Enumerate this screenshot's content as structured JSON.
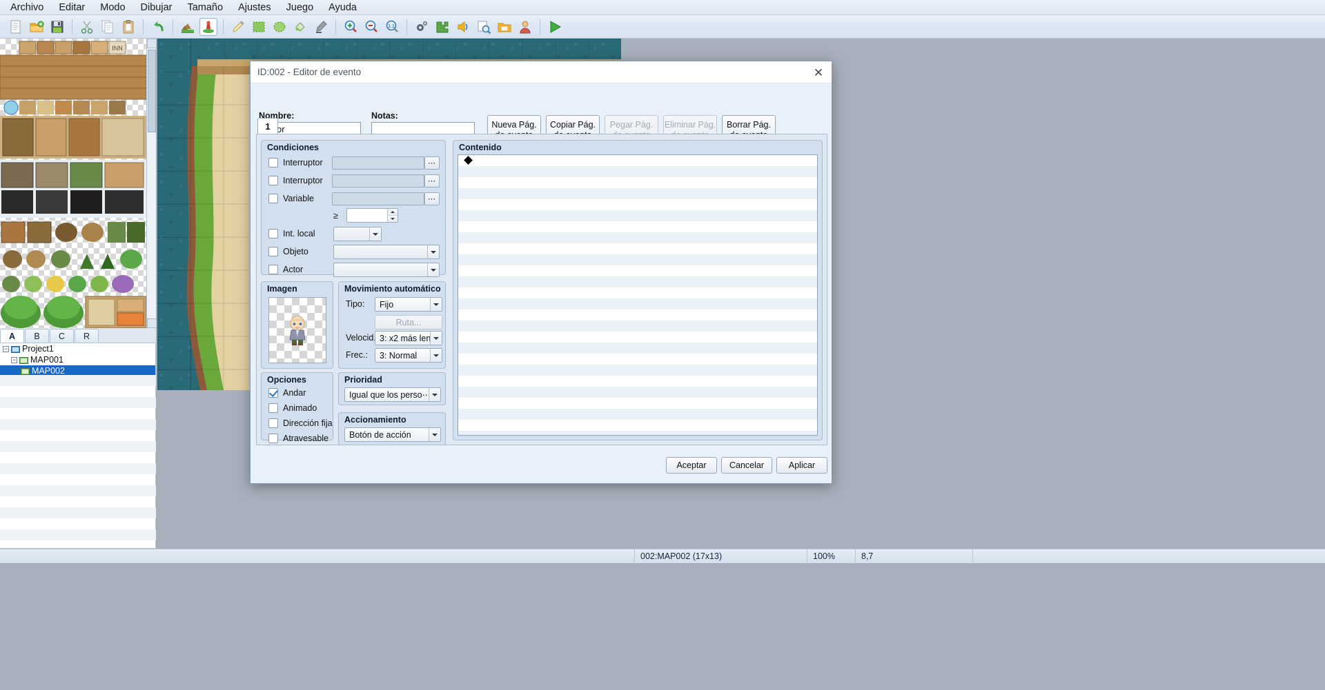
{
  "menu": {
    "items": [
      {
        "label": "Archivo"
      },
      {
        "label": "Editar"
      },
      {
        "label": "Modo"
      },
      {
        "label": "Dibujar"
      },
      {
        "label": "Tamaño"
      },
      {
        "label": "Ajustes"
      },
      {
        "label": "Juego"
      },
      {
        "label": "Ayuda"
      }
    ]
  },
  "toolbar": {
    "groups": [
      [
        "new-file-icon",
        "open-folder-icon",
        "save-disk-icon"
      ],
      [
        "cut-scissors-icon",
        "copy-icon",
        "paste-clipboard-icon"
      ],
      [
        "undo-arrow-icon"
      ],
      [
        "map-layer-icon",
        "event-pin-icon"
      ],
      [
        "pencil-icon",
        "rectangle-icon",
        "ellipse-icon",
        "fill-bucket-icon",
        "shadow-pen-icon"
      ],
      [
        "zoom-in-icon",
        "zoom-out-icon",
        "zoom-actual-icon"
      ],
      [
        "database-gear-icon",
        "plugin-puzzle-icon",
        "sound-test-icon",
        "event-search-icon",
        "resource-manager-icon",
        "character-gen-icon"
      ],
      [
        "playtest-play-icon"
      ]
    ]
  },
  "tileset_tabs": {
    "items": [
      {
        "label": "A",
        "selected": true
      },
      {
        "label": "B",
        "selected": false
      },
      {
        "label": "C",
        "selected": false
      },
      {
        "label": "R",
        "selected": false
      }
    ]
  },
  "map_tree": {
    "nodes": [
      {
        "label": "Project1",
        "indent": 1,
        "expander": "-",
        "icon": "project-icon",
        "selected": false
      },
      {
        "label": "MAP001",
        "indent": 2,
        "expander": "-",
        "icon": "map-icon",
        "selected": false
      },
      {
        "label": "MAP002",
        "indent": 3,
        "expander": "",
        "icon": "map-icon",
        "selected": true
      }
    ]
  },
  "statusbar": {
    "cells": [
      {
        "name": "map-info",
        "value": "002:MAP002  (17x13)"
      },
      {
        "name": "zoom-level",
        "value": "100%"
      },
      {
        "name": "cursor-coords",
        "value": "8,7"
      }
    ]
  },
  "dialog": {
    "title": "ID:002 - Editor de evento",
    "close_icon": "close-icon",
    "name_label": "Nombre:",
    "name_value": "señor",
    "notes_label": "Notas:",
    "notes_value": "",
    "page_buttons": [
      {
        "line1": "Nueva Pág.",
        "line2": "de evento",
        "disabled": false
      },
      {
        "line1": "Copiar Pág.",
        "line2": "de evento",
        "disabled": false
      },
      {
        "line1": "Pegar Pág.",
        "line2": "de evento",
        "disabled": true
      },
      {
        "line1": "Eliminar Pág.",
        "line2": "de evento",
        "disabled": true
      },
      {
        "line1": "Borrar Pág.",
        "line2": "de evento",
        "disabled": false
      }
    ],
    "page_tab": "1",
    "conditions": {
      "title": "Condiciones",
      "rows": [
        {
          "label": "Interruptor",
          "checked": false,
          "value": "",
          "control": "field-dots"
        },
        {
          "label": "Interruptor",
          "checked": false,
          "value": "",
          "control": "field-dots"
        },
        {
          "label": "Variable",
          "checked": false,
          "value": "",
          "control": "field-dots"
        }
      ],
      "comparator": "≥",
      "comparator_value": "",
      "local_switch": {
        "label": "Int. local",
        "checked": false,
        "value": ""
      },
      "item": {
        "label": "Objeto",
        "checked": false,
        "value": ""
      },
      "actor": {
        "label": "Actor",
        "checked": false,
        "value": ""
      }
    },
    "image": {
      "title": "Imagen",
      "sprite": "character-sprite"
    },
    "autonomous": {
      "title": "Movimiento automático",
      "type_label": "Tipo:",
      "type_value": "Fijo",
      "route_button": "Ruta...",
      "route_disabled": true,
      "speed_label": "Velocid.:",
      "speed_value": "3: x2 más len⋯",
      "freq_label": "Frec.:",
      "freq_value": "3: Normal"
    },
    "options": {
      "title": "Opciones",
      "items": [
        {
          "label": "Andar",
          "checked": true
        },
        {
          "label": "Animado",
          "checked": false
        },
        {
          "label": "Dirección fija",
          "checked": false
        },
        {
          "label": "Atravesable",
          "checked": false
        }
      ]
    },
    "priority": {
      "title": "Prioridad",
      "value": "Igual que los perso⋯"
    },
    "trigger": {
      "title": "Accionamiento",
      "value": "Botón de acción"
    },
    "content": {
      "title": "Contenido",
      "first_marker": "◆",
      "rows": 26
    },
    "footer": {
      "accept": "Aceptar",
      "cancel": "Cancelar",
      "apply": "Aplicar"
    }
  },
  "colors": {
    "accent": "#1668c8",
    "dialog_bg": "#e8f0fa",
    "group_bg": "#d2dfee",
    "water": "#2a6a78",
    "sand": "#e0cd9a",
    "grass": "#6aa83c"
  }
}
